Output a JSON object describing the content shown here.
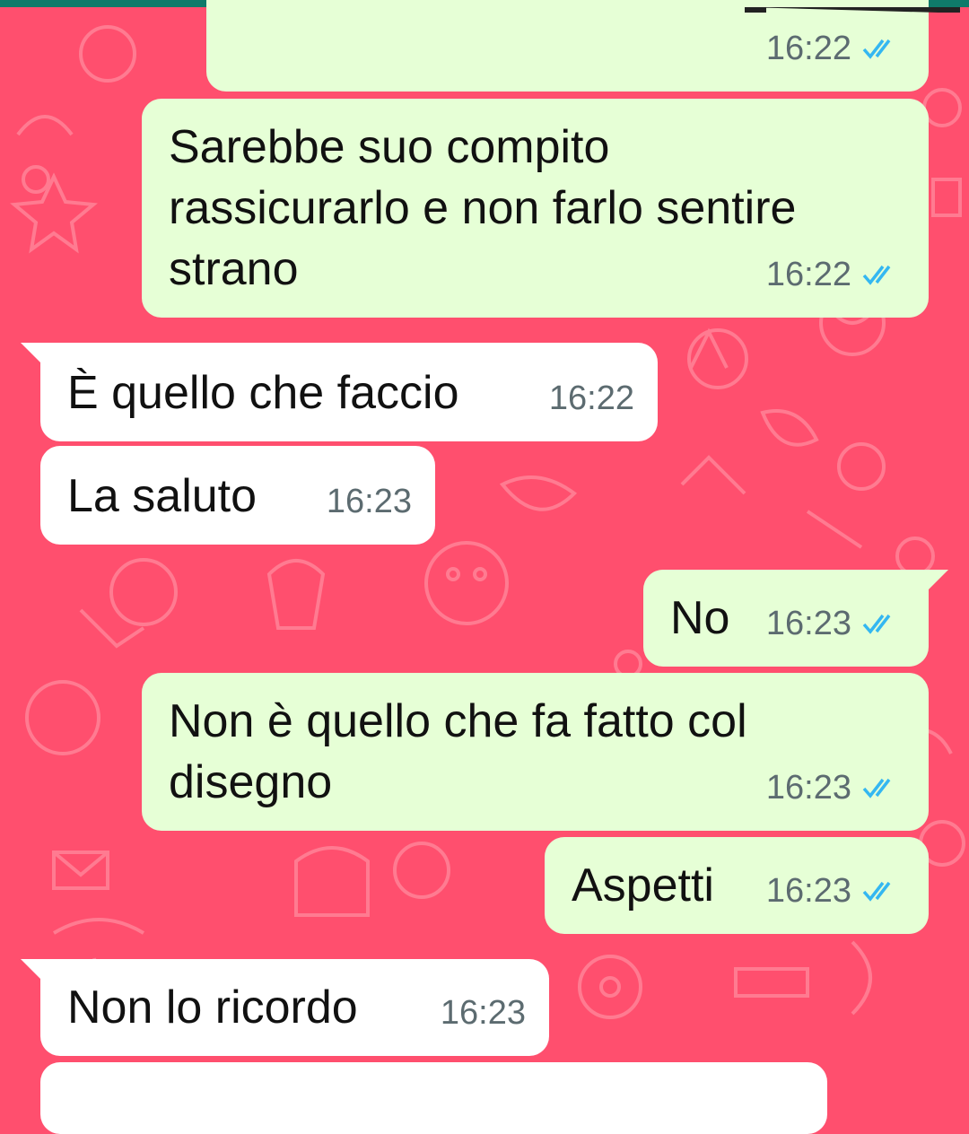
{
  "colors": {
    "background": "#ff4f6e",
    "outgoing_bubble": "#e6ffd6",
    "incoming_bubble": "#ffffff",
    "read_tick": "#34b7f1",
    "timestamp": "#5c6b70",
    "header_strip": "#0f7a6a"
  },
  "messages": [
    {
      "direction": "out",
      "text": "",
      "time": "16:22",
      "status": "read-double-tick"
    },
    {
      "direction": "out",
      "text": "Sarebbe suo compito\nrassicurarlo e non farlo sentire\nstrano",
      "time": "16:22",
      "status": "read-double-tick"
    },
    {
      "direction": "in",
      "text": "È quello che faccio",
      "time": "16:22"
    },
    {
      "direction": "in",
      "text": "La saluto",
      "time": "16:23"
    },
    {
      "direction": "out",
      "text": "No",
      "time": "16:23",
      "status": "read-double-tick"
    },
    {
      "direction": "out",
      "text": "Non è quello che fa fatto col\ndisegno",
      "time": "16:23",
      "status": "read-double-tick"
    },
    {
      "direction": "out",
      "text": "Aspetti",
      "time": "16:23",
      "status": "read-double-tick"
    },
    {
      "direction": "in",
      "text": "Non lo ricordo",
      "time": "16:23"
    },
    {
      "direction": "in",
      "text": "",
      "time": ""
    }
  ],
  "icons": {
    "read_status": "double-check-icon"
  }
}
